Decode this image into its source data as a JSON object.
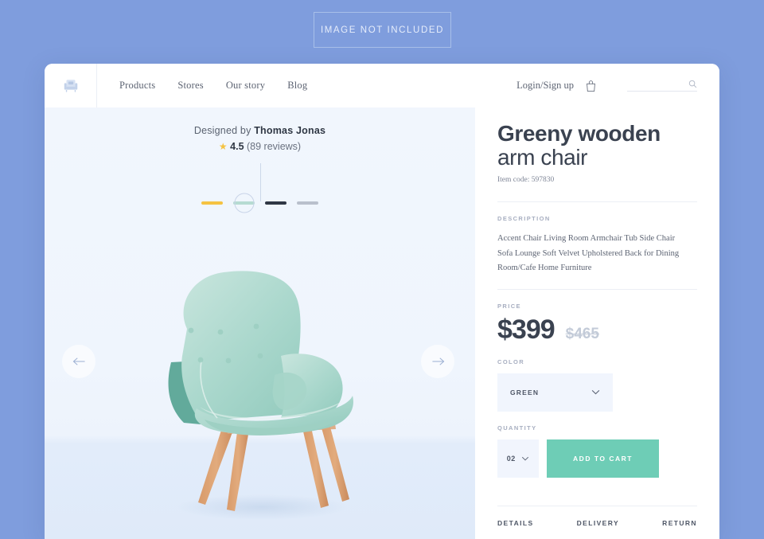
{
  "banner": {
    "text": "IMAGE NOT INCLUDED"
  },
  "header": {
    "logo_icon": "armchair-logo-icon",
    "nav": [
      {
        "label": "Products"
      },
      {
        "label": "Stores"
      },
      {
        "label": "Our story"
      },
      {
        "label": "Blog"
      }
    ],
    "login_label": "Login/Sign up",
    "cart_icon": "shopping-bag-icon",
    "search": {
      "value": "",
      "placeholder": "",
      "icon": "search-icon"
    }
  },
  "gallery": {
    "designer_prefix": "Designed by ",
    "designer_name": "Thomas Jonas",
    "rating": {
      "star_icon": "star-icon",
      "score": "4.5",
      "reviews": "(89 reviews)"
    },
    "prev_icon": "arrow-left-icon",
    "next_icon": "arrow-right-icon",
    "swatches": [
      {
        "name": "yellow",
        "color": "#f5c342",
        "selected": false
      },
      {
        "name": "green",
        "color": "#b6dbd2",
        "selected": true
      },
      {
        "name": "black",
        "color": "#2f3744",
        "selected": false
      },
      {
        "name": "grey",
        "color": "#b9c0cc",
        "selected": false
      }
    ]
  },
  "product": {
    "title_line1": "Greeny wooden",
    "title_line2": "arm chair",
    "item_code": "Item code: 597830",
    "description_label": "DESCRIPTION",
    "description": "Accent Chair Living Room Armchair Tub Side Chair Sofa Lounge Soft Velvet Upholstered Back for Dining Room/Cafe Home Furniture",
    "price_label": "PRICE",
    "price_current": "$399",
    "price_original": "$465",
    "color_label": "COLOR",
    "color_value": "GREEN",
    "color_chevron_icon": "chevron-down-icon",
    "quantity_label": "QUANTITY",
    "quantity_value": "02",
    "quantity_chevron_icon": "chevron-down-icon",
    "add_to_cart_label": "ADD TO CART"
  },
  "tabs": [
    {
      "label": "DETAILS"
    },
    {
      "label": "DELIVERY"
    },
    {
      "label": "RETURN"
    }
  ],
  "colors": {
    "page_background": "#7f9ddd",
    "accent_green": "#6ecdb6",
    "text_dark": "#3a4250",
    "muted": "#a7aec0"
  }
}
